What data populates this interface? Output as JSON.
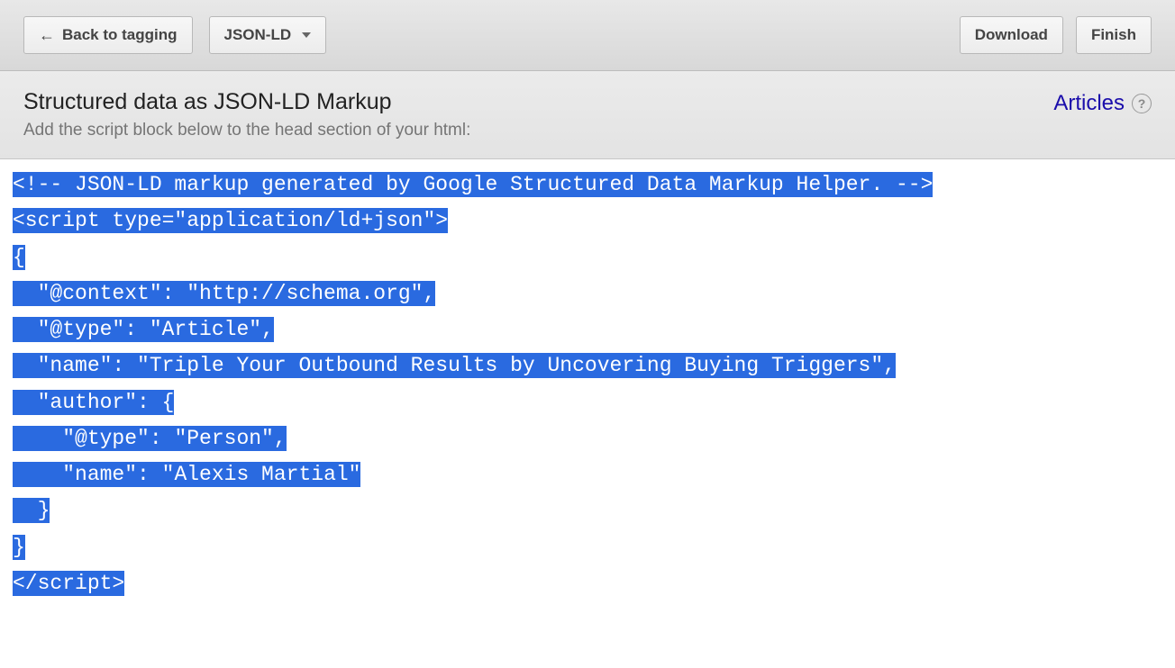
{
  "toolbar": {
    "back_label": "Back to tagging",
    "format_label": "JSON-LD",
    "download_label": "Download",
    "finish_label": "Finish"
  },
  "subheader": {
    "title": "Structured data as JSON-LD Markup",
    "description": "Add the script block below to the head section of your html:",
    "link_label": "Articles"
  },
  "code": {
    "lines": [
      "<!-- JSON-LD markup generated by Google Structured Data Markup Helper. -->",
      "<script type=\"application/ld+json\">",
      "{",
      "  \"@context\": \"http://schema.org\",",
      "  \"@type\": \"Article\",",
      "  \"name\": \"Triple Your Outbound Results by Uncovering Buying Triggers\",",
      "  \"author\": {",
      "    \"@type\": \"Person\",",
      "    \"name\": \"Alexis Martial\"",
      "  }",
      "}",
      "</script>"
    ]
  }
}
